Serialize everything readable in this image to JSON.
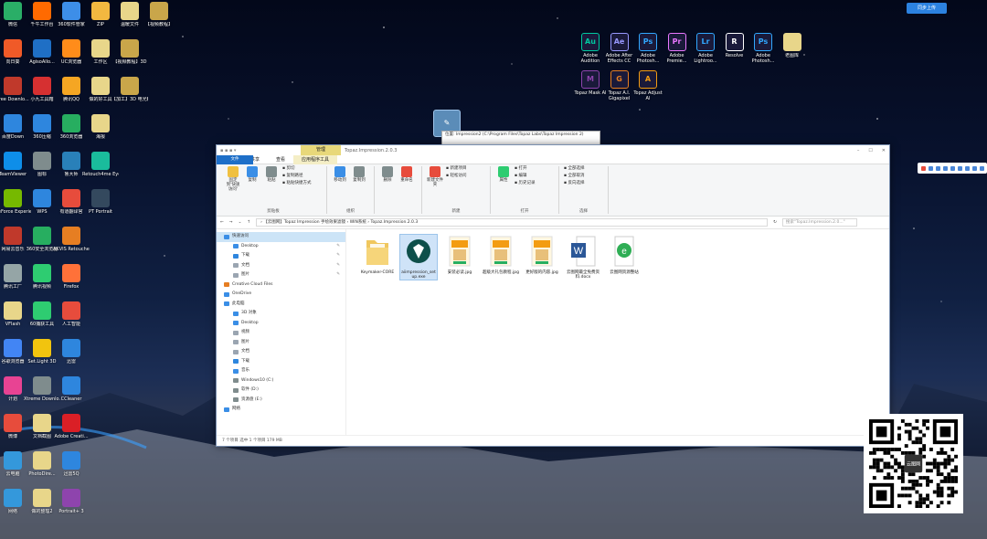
{
  "desktop_left": [
    {
      "label": "微信",
      "color": "#2aae67"
    },
    {
      "label": "千牛工作台",
      "color": "#ff6a00"
    },
    {
      "label": "360软件管家",
      "color": "#3d8ee8"
    },
    {
      "label": "ZIP",
      "color": "#f2b840"
    },
    {
      "label": "温暖文件",
      "color": "#e8d68a"
    },
    {
      "label": "【视频教程】",
      "color": "#c9a64a"
    },
    {
      "label": "向日葵",
      "color": "#f05a28"
    },
    {
      "label": "AgisoAllo...",
      "color": "#1f6fc5"
    },
    {
      "label": "UC浏览器",
      "color": "#ff8c1a"
    },
    {
      "label": "工作区",
      "color": "#e8d68a"
    },
    {
      "label": "【视频教程】3D",
      "color": "#c9a64a"
    },
    {
      "label": "Free Downlo...",
      "color": "#c0392b"
    },
    {
      "label": "小九工具箱",
      "color": "#d63031"
    },
    {
      "label": "腾讯QQ",
      "color": "#f5a623"
    },
    {
      "label": "做的好工具",
      "color": "#e8d68a"
    },
    {
      "label": "【加工】3D 电光精灵",
      "color": "#c9a64a"
    },
    {
      "label": "百度Down",
      "color": "#2e86de"
    },
    {
      "label": "360压缩",
      "color": "#2e86de"
    },
    {
      "label": "360浏览器",
      "color": "#27ae60"
    },
    {
      "label": "海报",
      "color": "#e8d68a"
    },
    {
      "label": "TeamViewer",
      "color": "#0e8ee9"
    },
    {
      "label": "图标",
      "color": "#7f8c8d"
    },
    {
      "label": "鲁大师",
      "color": "#2980b9"
    },
    {
      "label": "Retouch4me Eye Vess...",
      "color": "#1abc9c"
    },
    {
      "label": "GeForce Experience",
      "color": "#76b900"
    },
    {
      "label": "WPS",
      "color": "#2e86de"
    },
    {
      "label": "有道翻译官",
      "color": "#e74c3c"
    },
    {
      "label": "PT Portrait",
      "color": "#34495e"
    },
    {
      "label": "网易云音乐",
      "color": "#c0392b"
    },
    {
      "label": "360安全浏览器",
      "color": "#27ae60"
    },
    {
      "label": "AKVIS Retoucher",
      "color": "#e67e22"
    },
    {
      "label": "腾讯工厂",
      "color": "#95a5a6"
    },
    {
      "label": "腾讯视频",
      "color": "#2ecc71"
    },
    {
      "label": "Firefox",
      "color": "#ff7139"
    },
    {
      "label": "VFlash",
      "color": "#e8d68a"
    },
    {
      "label": "60捕获工具",
      "color": "#2ecc71"
    },
    {
      "label": "人工智能",
      "color": "#e74c3c"
    },
    {
      "label": "谷歌浏览器",
      "color": "#4285f4"
    },
    {
      "label": "Set.Light 3D",
      "color": "#f1c40f"
    },
    {
      "label": "迅雷",
      "color": "#2e86de"
    },
    {
      "label": "计划",
      "color": "#e84393"
    },
    {
      "label": "Xtreme Downlo...",
      "color": "#7f8c8d"
    },
    {
      "label": "CCleaner",
      "color": "#2e86de"
    },
    {
      "label": "微博",
      "color": "#e74c3c"
    },
    {
      "label": "文档截图",
      "color": "#e8d68a"
    },
    {
      "label": "Adobe Creati...",
      "color": "#da1f26"
    },
    {
      "label": "云电脑",
      "color": "#3498db"
    },
    {
      "label": "PhotoDire...",
      "color": "#e8d68a"
    },
    {
      "label": "迅雷5Q",
      "color": "#2e86de"
    },
    {
      "label": "网络",
      "color": "#3498db"
    },
    {
      "label": "做的整理2",
      "color": "#e8d68a"
    },
    {
      "label": "Portrait+ 3",
      "color": "#8e44ad"
    },
    {
      "label": "360安全卫士",
      "color": "#27ae60"
    },
    {
      "label": "做的整理1",
      "color": "#e8d68a"
    }
  ],
  "desktop_right": [
    {
      "label": "Adobe Audition",
      "abbr": "Au",
      "color": "#00c8a0"
    },
    {
      "label": "Adobe After Effects CC",
      "abbr": "Ae",
      "color": "#9999ff"
    },
    {
      "label": "Adobe Photosh...",
      "abbr": "Ps",
      "color": "#31a8ff"
    },
    {
      "label": "Adobe Premie...",
      "abbr": "Pr",
      "color": "#ea77ff"
    },
    {
      "label": "Adobe Lightroo...",
      "abbr": "Lr",
      "color": "#31a8ff"
    },
    {
      "label": "Resolve",
      "abbr": "R",
      "color": "#ffffff"
    },
    {
      "label": "Adobe Photosh...",
      "abbr": "Ps",
      "color": "#31a8ff"
    },
    {
      "label": "老图库",
      "abbr": "",
      "color": "#e8d68a"
    },
    {
      "label": "Topaz Mask AI",
      "abbr": "M",
      "color": "#8e44ad"
    },
    {
      "label": "Topaz A.I. Gigapixel",
      "abbr": "G",
      "color": "#e67e22"
    },
    {
      "label": "Topaz Adjust AI",
      "abbr": "A",
      "color": "#f39c12"
    }
  ],
  "dragged_icon_label": "",
  "tooltip_text": "位置: Impression2 (C:\\Program Files\\Topaz Labs\\Topaz Impression 2)",
  "window": {
    "title": "Topaz.Impression.2.0.3",
    "context_tab": "管理",
    "tabs": [
      "文件",
      "主页",
      "共享",
      "查看",
      "应用程序工具"
    ],
    "ribbon_groups": [
      {
        "name": "剪贴板",
        "buttons": [
          "固定到'快速访问'",
          "复制",
          "粘贴"
        ],
        "small": [
          "剪切",
          "复制路径",
          "粘贴快捷方式"
        ]
      },
      {
        "name": "组织",
        "buttons": [
          "移动到",
          "复制到"
        ],
        "small": []
      },
      {
        "name": "",
        "buttons": [
          "删除",
          "重命名"
        ],
        "small": []
      },
      {
        "name": "新建",
        "buttons": [
          "新建文件夹"
        ],
        "small": [
          "新建项目",
          "轻松访问"
        ]
      },
      {
        "name": "打开",
        "buttons": [
          "属性"
        ],
        "small": [
          "打开",
          "编辑",
          "历史记录"
        ]
      },
      {
        "name": "选择",
        "buttons": [],
        "small": [
          "全部选择",
          "全部取消",
          "反向选择"
        ]
      }
    ],
    "address_path": "› 【云图网】Topaz Impression 手绘效果滤镜 › WIN系统 › Topaz.Impression.2.0.3",
    "search_placeholder": "搜索\"Topaz.Impression.2.0...\"",
    "nav_items": [
      {
        "label": "快速访问",
        "color": "#3a8ee6",
        "indent": 0,
        "selected": true
      },
      {
        "label": "Desktop",
        "color": "#3a8ee6",
        "indent": 1
      },
      {
        "label": "下载",
        "color": "#2e86de",
        "indent": 1
      },
      {
        "label": "文档",
        "color": "#9aa5b1",
        "indent": 1
      },
      {
        "label": "图片",
        "color": "#9aa5b1",
        "indent": 1
      },
      {
        "label": "Creative Cloud Files",
        "color": "#e67e22",
        "indent": 0
      },
      {
        "label": "OneDrive",
        "color": "#3a8ee6",
        "indent": 0
      },
      {
        "label": "此电脑",
        "color": "#3a8ee6",
        "indent": 0
      },
      {
        "label": "3D 对象",
        "color": "#3a8ee6",
        "indent": 1
      },
      {
        "label": "Desktop",
        "color": "#3a8ee6",
        "indent": 1
      },
      {
        "label": "视频",
        "color": "#9aa5b1",
        "indent": 1
      },
      {
        "label": "图片",
        "color": "#9aa5b1",
        "indent": 1
      },
      {
        "label": "文档",
        "color": "#9aa5b1",
        "indent": 1
      },
      {
        "label": "下载",
        "color": "#2e86de",
        "indent": 1
      },
      {
        "label": "音乐",
        "color": "#3a8ee6",
        "indent": 1
      },
      {
        "label": "Windows10 (C:)",
        "color": "#7f8c8d",
        "indent": 1
      },
      {
        "label": "软件 (D:)",
        "color": "#7f8c8d",
        "indent": 1
      },
      {
        "label": "资源盘 (E:)",
        "color": "#7f8c8d",
        "indent": 1
      },
      {
        "label": "网络",
        "color": "#3a8ee6",
        "indent": 0
      }
    ],
    "files": [
      {
        "label": "Keymaker-CORE",
        "kind": "folder"
      },
      {
        "label": "aiimpression_setup.exe",
        "kind": "exe",
        "selected": true
      },
      {
        "label": "安装必读.jpg",
        "kind": "image"
      },
      {
        "label": "超级大礼包教程.jpg",
        "kind": "image"
      },
      {
        "label": "更好版的内容.jpg",
        "kind": "image"
      },
      {
        "label": "云图网最全免费资料.docx",
        "kind": "word"
      },
      {
        "label": "云图网资源整站",
        "kind": "ie"
      }
    ],
    "status": "7 个项目    选中 1 个项目  179 MB"
  },
  "qr": {
    "center_label": "云图网"
  },
  "top_right_button": "同步上传"
}
